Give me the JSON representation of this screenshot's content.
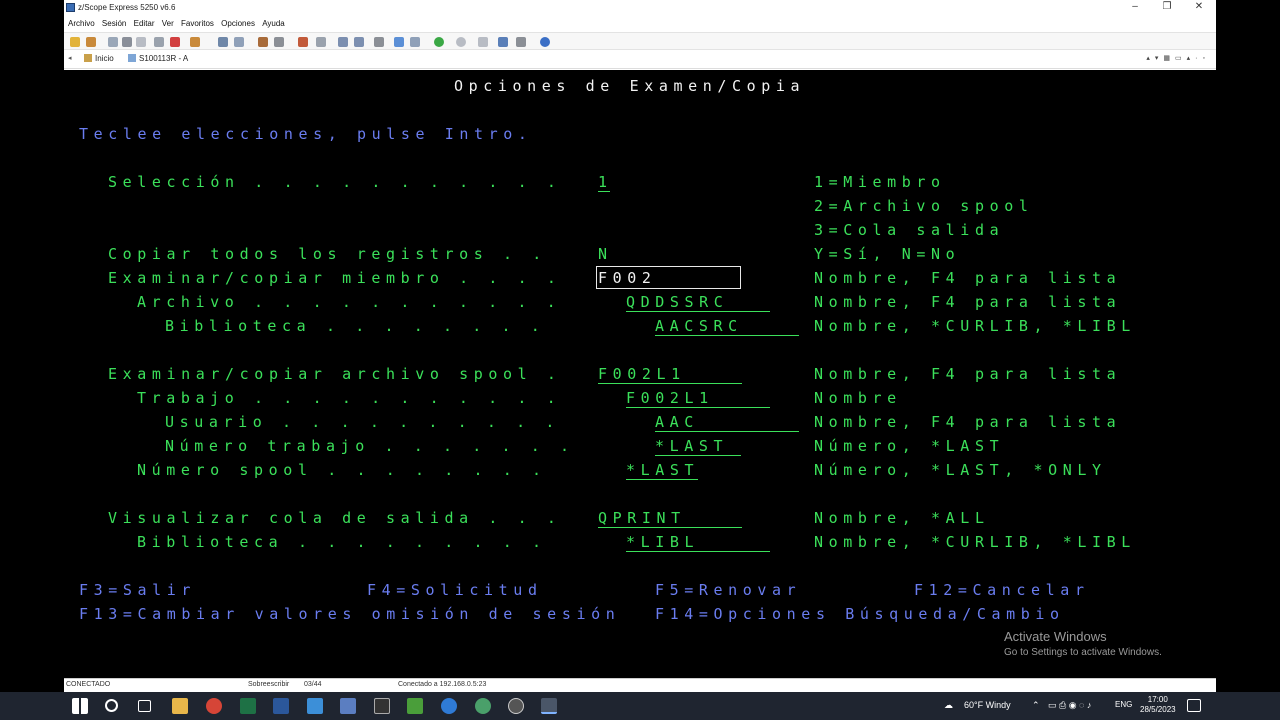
{
  "window": {
    "title": "z/Scope Express 5250 v6.6",
    "controls": {
      "minimize": "–",
      "restore": "❐",
      "close": "✕"
    }
  },
  "menu": [
    "Archivo",
    "Sesión",
    "Editar",
    "Ver",
    "Favoritos",
    "Opciones",
    "Ayuda"
  ],
  "tabs": [
    {
      "label": "Inicio"
    },
    {
      "label": "S100113R - A"
    }
  ],
  "screen": {
    "title": "Opciones de Examen/Copia",
    "instruction": "Teclee elecciones, pulse Intro.",
    "rows": [
      {
        "label": "Selección . . . . . . . . . . .",
        "value": "1",
        "hint": "1=Miembro"
      },
      {
        "hint": "2=Archivo spool"
      },
      {
        "hint": "3=Cola salida"
      },
      {
        "label": "Copiar todos los registros . .",
        "value": "N",
        "hint": "Y=Sí, N=No"
      },
      {
        "label": "Examinar/copiar miembro . . . .",
        "value": "F002",
        "hint": "Nombre, F4 para lista"
      },
      {
        "label": "Archivo . . . . . . . . . . .",
        "value": "QDDSSRC",
        "hint": "Nombre, F4 para lista"
      },
      {
        "label": "Biblioteca . . . . . . . .",
        "value": "AACSRC",
        "hint": "Nombre, *CURLIB, *LIBL"
      },
      {
        "label": "Examinar/copiar archivo spool .",
        "value": "F002L1",
        "hint": "Nombre, F4 para lista"
      },
      {
        "label": "Trabajo . . . . . . . . . . .",
        "value": "F002L1",
        "hint": "Nombre"
      },
      {
        "label": "Usuario . . . . . . . . . .",
        "value": "AAC",
        "hint": "Nombre, F4 para lista"
      },
      {
        "label": "Número trabajo . . . . . . .",
        "value": "*LAST",
        "hint": "Número, *LAST"
      },
      {
        "label": "Número spool . . . . . . . .",
        "value": "*LAST",
        "hint": "Número, *LAST, *ONLY"
      },
      {
        "label": "Visualizar cola de salida . . .",
        "value": "QPRINT",
        "hint": "Nombre, *ALL"
      },
      {
        "label": "Biblioteca . . . . . . . . .",
        "value": "*LIBL",
        "hint": "Nombre, *CURLIB, *LIBL"
      }
    ],
    "fkeys": {
      "f3": "F3=Salir",
      "f4": "F4=Solicitud",
      "f5": "F5=Renovar",
      "f12": "F12=Cancelar",
      "f13": "F13=Cambiar valores omisión de sesión",
      "f14": "F14=Opciones Búsqueda/Cambio"
    }
  },
  "watermark": {
    "line1": "Activate Windows",
    "line2": "Go to Settings to activate Windows."
  },
  "status": {
    "connection": "CONECTADO",
    "mode": "Sobreescribir",
    "cursor": "03/44",
    "host": "Conectado a 192.168.0.5:23"
  },
  "taskbar": {
    "weather": "60°F  Windy",
    "lang": "ENG",
    "time": "17:00",
    "date": "28/5/2023"
  },
  "colors": {
    "terminal_green": "#3be05a",
    "terminal_blue": "#6a7df0",
    "terminal_bg": "#000000"
  }
}
